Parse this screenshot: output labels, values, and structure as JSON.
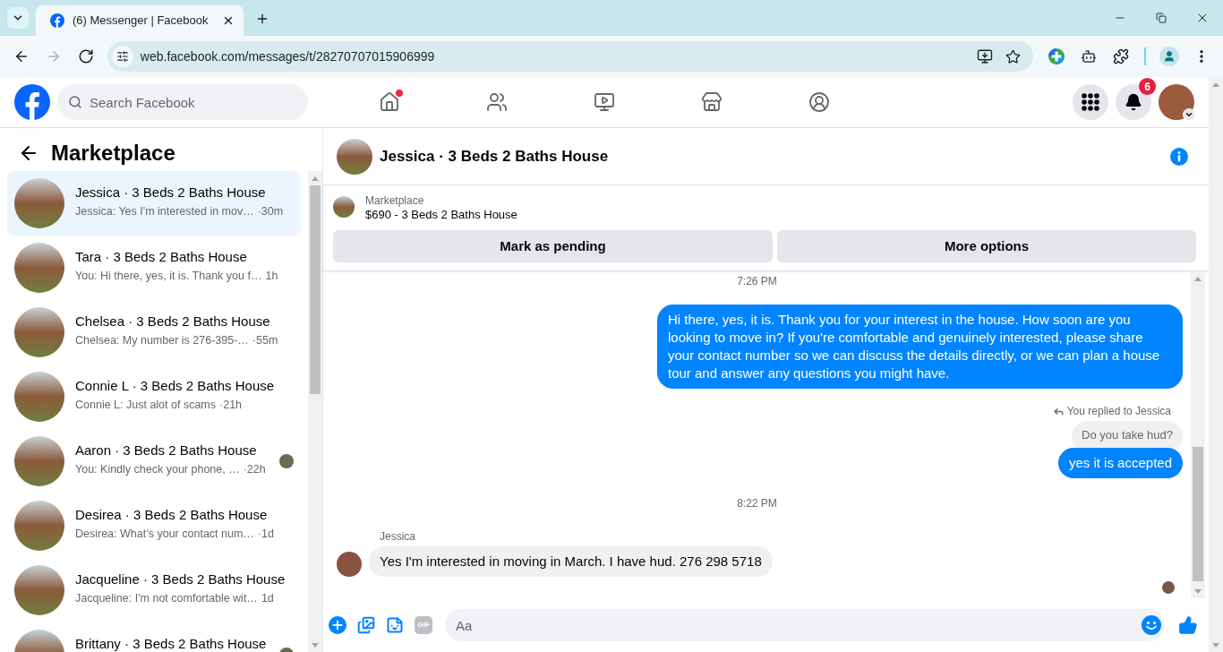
{
  "browser": {
    "tab": {
      "title": "(6) Messenger | Facebook"
    },
    "nav_buttons": [
      {
        "kind": "back",
        "disabled": false
      },
      {
        "kind": "forward",
        "disabled": true
      },
      {
        "kind": "reload",
        "disabled": false
      }
    ],
    "url": "web.facebook.com/messages/t/28270707015906999"
  },
  "header": {
    "search": {
      "placeholder": "Search Facebook"
    },
    "nav": [
      {
        "kind": "home",
        "selected": false,
        "dot": true
      },
      {
        "kind": "friends",
        "selected": false,
        "dot": false
      },
      {
        "kind": "video",
        "selected": false,
        "dot": false
      },
      {
        "kind": "marketplace",
        "selected": false,
        "dot": false
      },
      {
        "kind": "groups",
        "selected": false,
        "dot": false
      }
    ],
    "notifications": {
      "count": "6"
    }
  },
  "sidebar": {
    "title": "Marketplace",
    "items": [
      {
        "title": "Jessica · 3 Beds 2 Baths House",
        "preview": "Jessica: Yes I'm interested in mov…",
        "time": "·30m",
        "selected": true,
        "seen_avatar": false
      },
      {
        "title": "Tara · 3 Beds 2 Baths House",
        "preview": "You: Hi there, yes, it is. Thank you f…",
        "time": "1h",
        "selected": false,
        "seen_avatar": false
      },
      {
        "title": "Chelsea · 3 Beds 2 Baths House",
        "preview": "Chelsea: My number is 276-395-…",
        "time": "·55m",
        "selected": false,
        "seen_avatar": false
      },
      {
        "title": "Connie L · 3 Beds 2 Baths House",
        "preview": "Connie L: Just alot of scams",
        "time": "·21h",
        "selected": false,
        "seen_avatar": false
      },
      {
        "title": "Aaron · 3 Beds 2 Baths House",
        "preview": "You: Kindly check your phone, …",
        "time": "·22h",
        "selected": false,
        "seen_avatar": true
      },
      {
        "title": "Desirea · 3 Beds 2 Baths House",
        "preview": "Desirea: What’s your contact num…",
        "time": "·1d",
        "selected": false,
        "seen_avatar": false
      },
      {
        "title": "Jacqueline · 3 Beds 2 Baths House",
        "preview": "Jacqueline: I'm not comfortable wit…",
        "time": "1d",
        "selected": false,
        "seen_avatar": false
      },
      {
        "title": "Brittany · 3 Beds 2 Baths House",
        "selected": false,
        "seen_avatar": true
      }
    ]
  },
  "chat": {
    "title": "Jessica · 3 Beds 2 Baths House",
    "listing": {
      "label": "Marketplace",
      "title": "$690 - 3 Beds 2 Baths House",
      "buttons": [
        "Mark as pending",
        "More options"
      ]
    },
    "messages": [
      {
        "kind": "time",
        "text": "7:26 PM"
      },
      {
        "kind": "outgoing",
        "text": "Hi there, yes, it is. Thank you for your interest in the house. How soon are you looking to move in? If you're comfortable and genuinely interested, please share your contact number so we can discuss the details directly, or we can plan a house tour and answer any questions you might have."
      },
      {
        "kind": "reply_note",
        "text": "You replied to Jessica"
      },
      {
        "kind": "quoted",
        "text": "Do you take hud?"
      },
      {
        "kind": "outgoing",
        "text": "yes it is accepted"
      },
      {
        "kind": "time",
        "text": "8:22 PM"
      },
      {
        "kind": "sender",
        "text": "Jessica"
      },
      {
        "kind": "incoming",
        "text": "Yes I'm interested in moving in March. I have hud. 276 298 5718"
      },
      {
        "kind": "seen"
      }
    ],
    "composer": {
      "gif_label": "GIF",
      "placeholder": "Aa"
    }
  }
}
